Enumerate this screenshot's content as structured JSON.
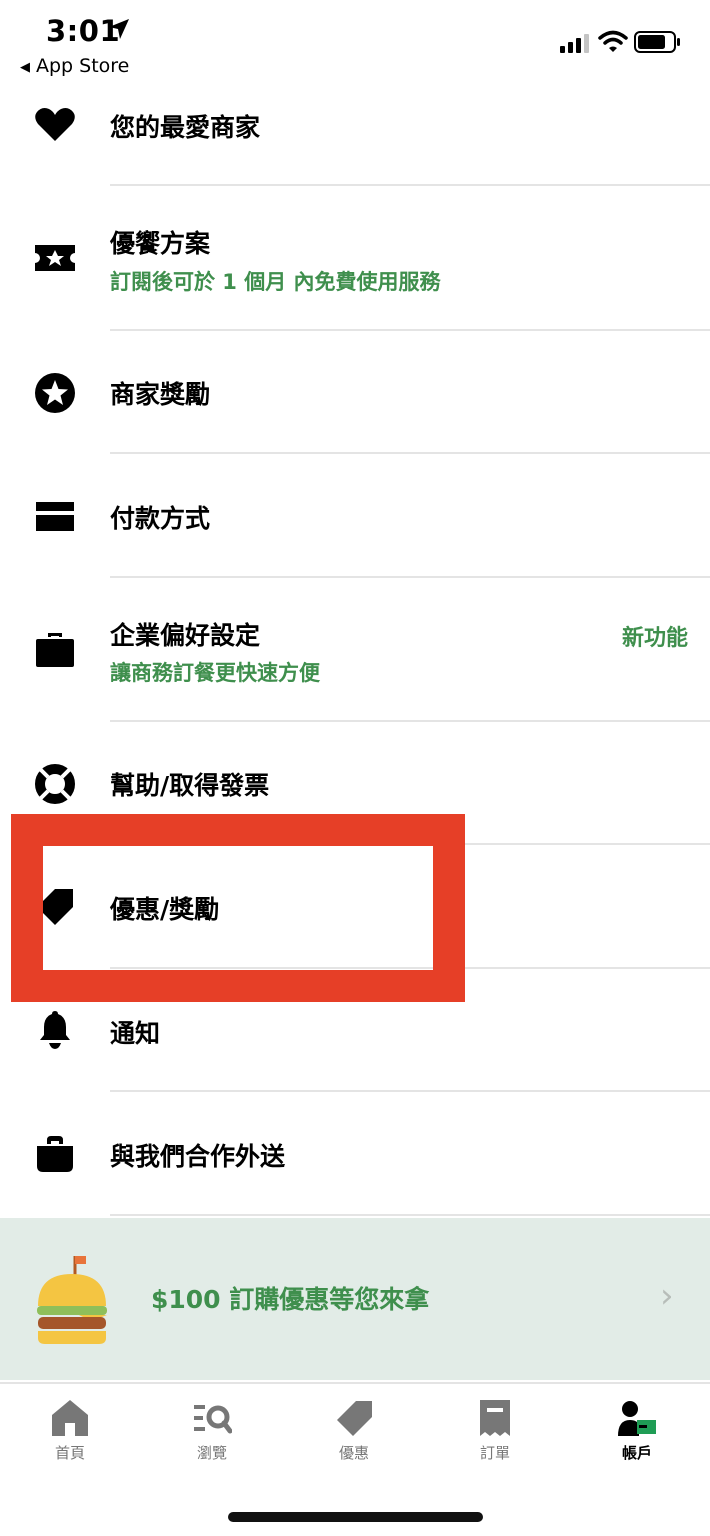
{
  "status_bar": {
    "time": "3:01",
    "back_app": "App Store"
  },
  "menu": {
    "items": [
      {
        "label": "您的最愛商家",
        "icon": "heart-icon"
      },
      {
        "label": "優饗方案",
        "subtitle": "訂閱後可於 1 個月 內免費使用服務",
        "icon": "ticket-icon"
      },
      {
        "label": "商家獎勵",
        "icon": "star-icon"
      },
      {
        "label": "付款方式",
        "icon": "credit-card-icon"
      },
      {
        "label": "企業偏好設定",
        "subtitle": "讓商務訂餐更快速方便",
        "badge": "新功能",
        "icon": "briefcase-icon"
      },
      {
        "label": "幫助/取得發票",
        "icon": "lifebuoy-icon"
      },
      {
        "label": "優惠/獎勵",
        "icon": "tag-icon"
      },
      {
        "label": "通知",
        "icon": "bell-icon"
      },
      {
        "label": "與我們合作外送",
        "icon": "bag-icon"
      }
    ]
  },
  "promo": {
    "text": "$100 訂購優惠等您來拿",
    "icon": "burger-icon"
  },
  "tabs": [
    {
      "label": "首頁",
      "icon": "home-icon"
    },
    {
      "label": "瀏覽",
      "icon": "browse-icon"
    },
    {
      "label": "優惠",
      "icon": "offers-tag-icon"
    },
    {
      "label": "訂單",
      "icon": "receipt-icon"
    },
    {
      "label": "帳戶",
      "icon": "account-icon",
      "active": true
    }
  ],
  "colors": {
    "accent_green": "#3f8f4d",
    "highlight_red": "#e63f27",
    "promo_bg": "#e2ece7"
  }
}
